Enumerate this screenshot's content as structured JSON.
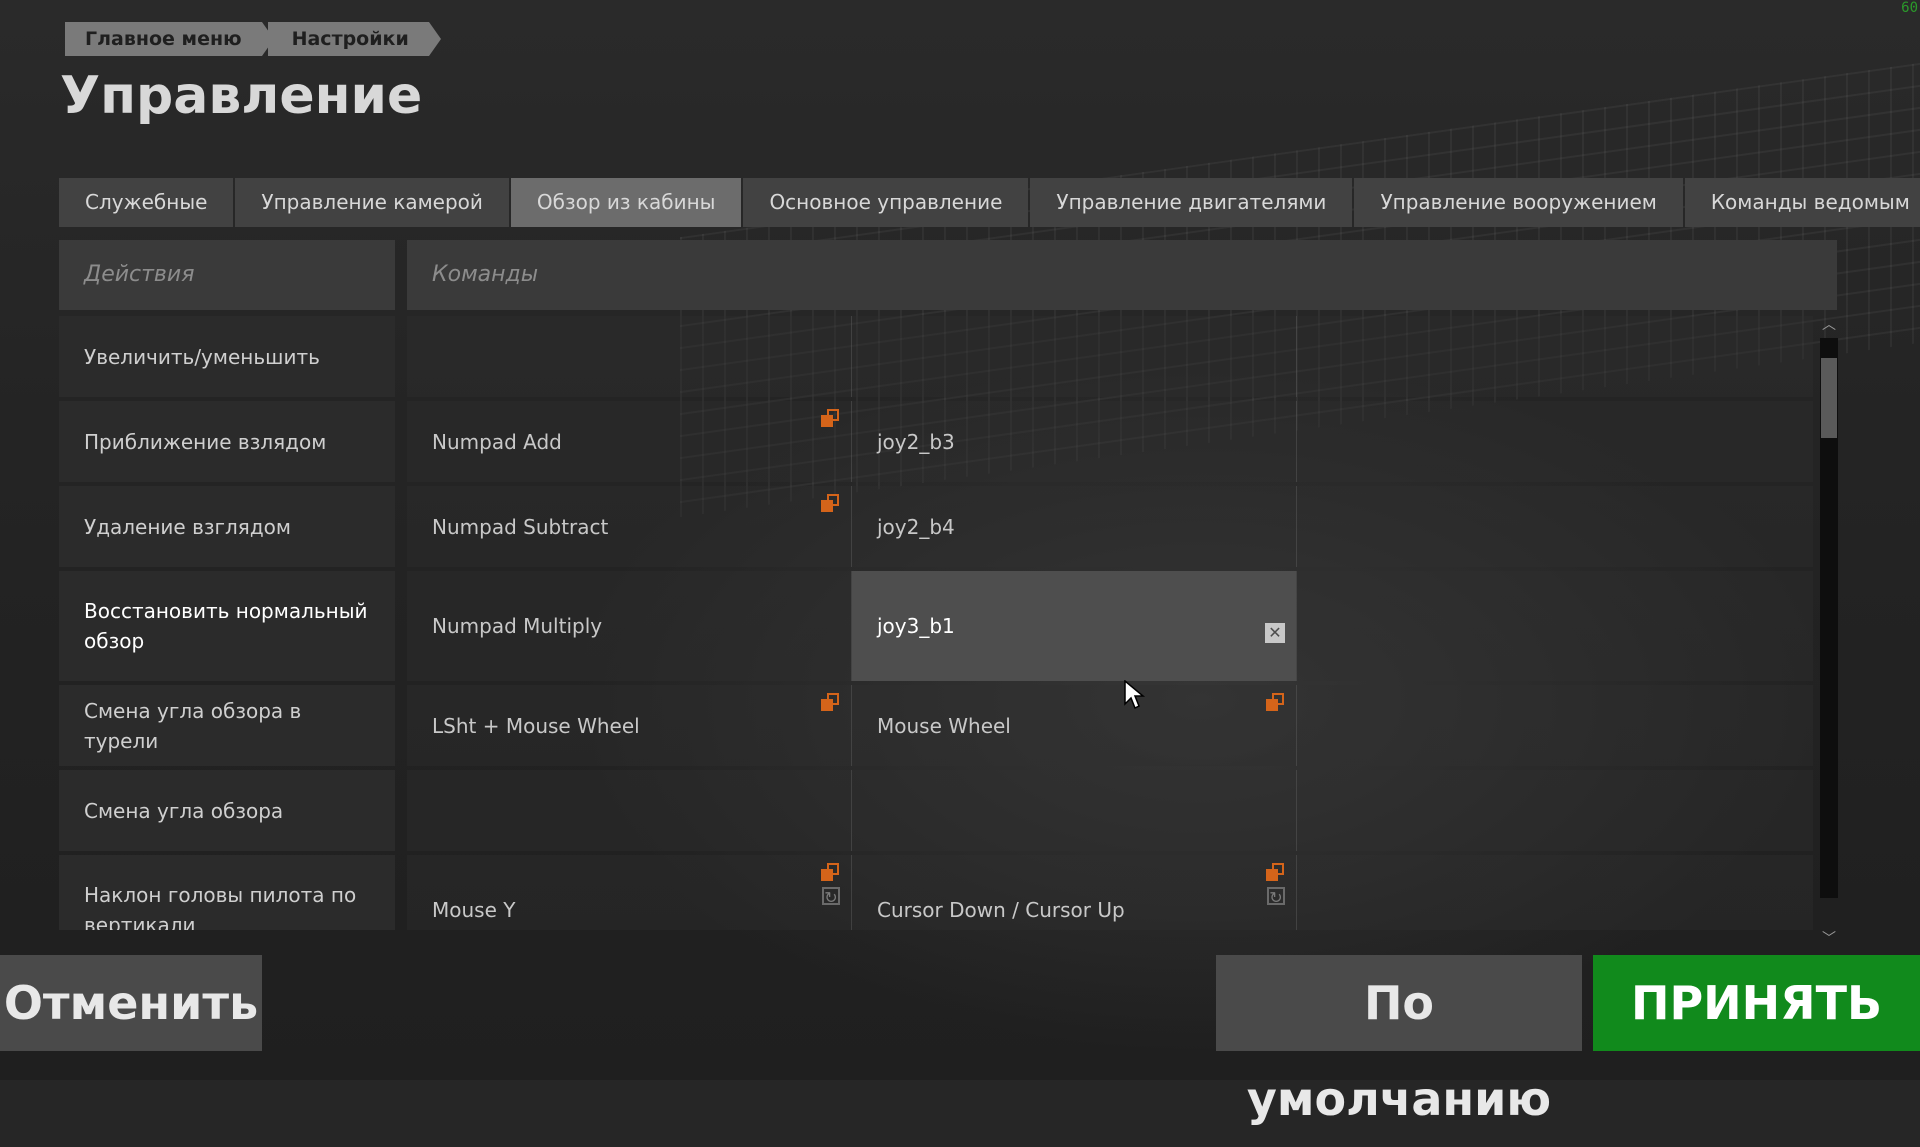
{
  "fps": "60",
  "breadcrumb": [
    "Главное меню",
    "Настройки"
  ],
  "page_title": "Управление",
  "tabs": [
    {
      "label": "Служебные"
    },
    {
      "label": "Управление камерой"
    },
    {
      "label": "Обзор из кабины",
      "active": true
    },
    {
      "label": "Основное управление"
    },
    {
      "label": "Управление двигателями"
    },
    {
      "label": "Управление вооружением"
    },
    {
      "label": "Команды ведомым"
    }
  ],
  "headers": {
    "actions": "Действия",
    "commands": "Команды"
  },
  "rows": [
    {
      "action": "Увеличить/уменьшить",
      "cmd1": "",
      "cmd2": "",
      "cmd3": ""
    },
    {
      "action": "Приближение взлядом",
      "cmd1": "Numpad Add",
      "cmd2": "joy2_b3",
      "cmd3": ""
    },
    {
      "action": "Удаление взглядом",
      "cmd1": "Numpad Subtract",
      "cmd2": "joy2_b4",
      "cmd3": ""
    },
    {
      "action": "Восстановить нормальный обзор",
      "cmd1": "Numpad Multiply",
      "cmd2": "joy3_b1",
      "cmd3": ""
    },
    {
      "action": "Смена угла обзора в турели",
      "cmd1": "LSht + Mouse Wheel",
      "cmd2": "Mouse Wheel",
      "cmd3": ""
    },
    {
      "action": "Смена угла обзора",
      "cmd1": "",
      "cmd2": "",
      "cmd3": ""
    },
    {
      "action": "Наклон головы пилота по вертикали",
      "cmd1": "Mouse Y",
      "cmd2": "Cursor Down / Cursor Up",
      "cmd3": ""
    }
  ],
  "buttons": {
    "cancel": "Отменить",
    "default": "По умолчанию",
    "accept": "ПРИНЯТЬ"
  },
  "colors": {
    "accent_orange": "#d4641a",
    "accept_green": "#118a1c"
  }
}
